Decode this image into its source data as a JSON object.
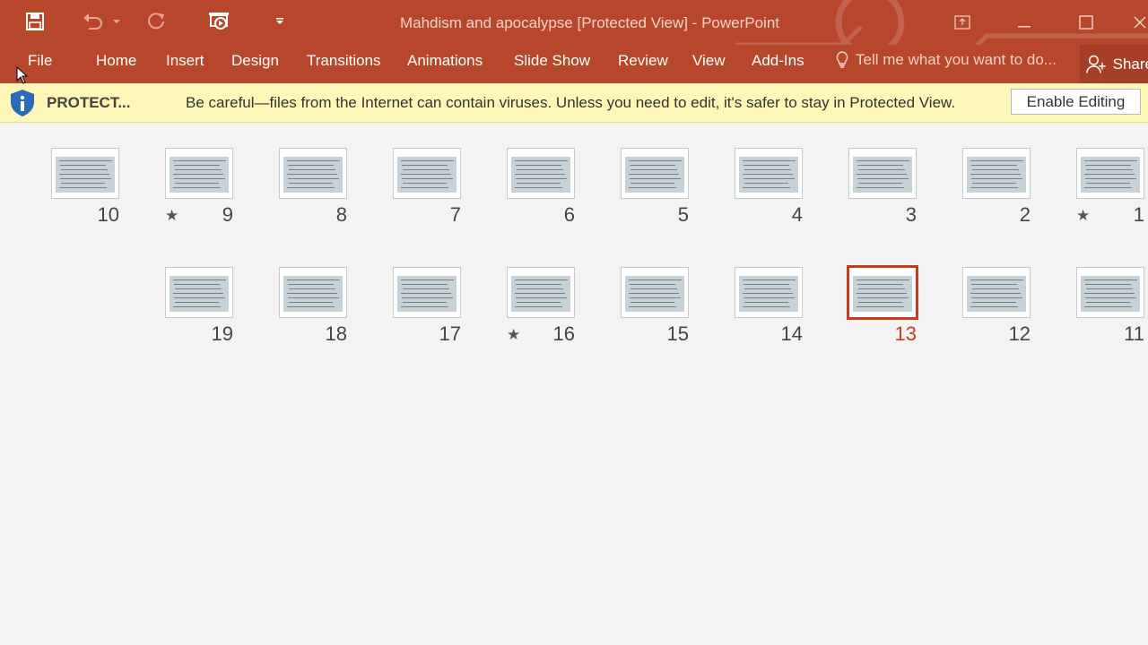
{
  "window": {
    "title": "Mahdism and apocalypse [Protected View] - PowerPoint"
  },
  "quick_access": {
    "save_icon": "save-icon",
    "undo_icon": "undo-icon",
    "redo_icon": "redo-icon",
    "present_icon": "start-from-beginning-icon",
    "customize_icon": "customize-toolbar-icon"
  },
  "ribbon": {
    "tabs": [
      "File",
      "Home",
      "Insert",
      "Design",
      "Transitions",
      "Animations",
      "Slide Show",
      "Review",
      "View",
      "Add-Ins"
    ],
    "tell_me": "Tell me what you want to do...",
    "share": "Share"
  },
  "message_bar": {
    "label": "PROTECT...",
    "text": "Be careful—files from the Internet can contain viruses. Unless you need to edit, it's safer to stay in Protected View.",
    "button": "Enable Editing"
  },
  "slides": {
    "row1": [
      {
        "number": "10",
        "star": false,
        "selected": false
      },
      {
        "number": "9",
        "star": true,
        "selected": false
      },
      {
        "number": "8",
        "star": false,
        "selected": false
      },
      {
        "number": "7",
        "star": false,
        "selected": false
      },
      {
        "number": "6",
        "star": false,
        "selected": false
      },
      {
        "number": "5",
        "star": false,
        "selected": false
      },
      {
        "number": "4",
        "star": false,
        "selected": false
      },
      {
        "number": "3",
        "star": false,
        "selected": false
      },
      {
        "number": "2",
        "star": false,
        "selected": false
      },
      {
        "number": "1",
        "star": true,
        "selected": false
      }
    ],
    "row2": [
      {
        "number": "19",
        "star": false,
        "selected": false
      },
      {
        "number": "18",
        "star": false,
        "selected": false
      },
      {
        "number": "17",
        "star": false,
        "selected": false
      },
      {
        "number": "16",
        "star": true,
        "selected": false
      },
      {
        "number": "15",
        "star": false,
        "selected": false
      },
      {
        "number": "14",
        "star": false,
        "selected": false
      },
      {
        "number": "13",
        "star": false,
        "selected": true
      },
      {
        "number": "12",
        "star": false,
        "selected": false
      },
      {
        "number": "11",
        "star": false,
        "selected": false
      }
    ]
  },
  "colors": {
    "accent": "#b7472a",
    "selected": "#c43e1c",
    "message_bar": "#fcf7b6"
  }
}
